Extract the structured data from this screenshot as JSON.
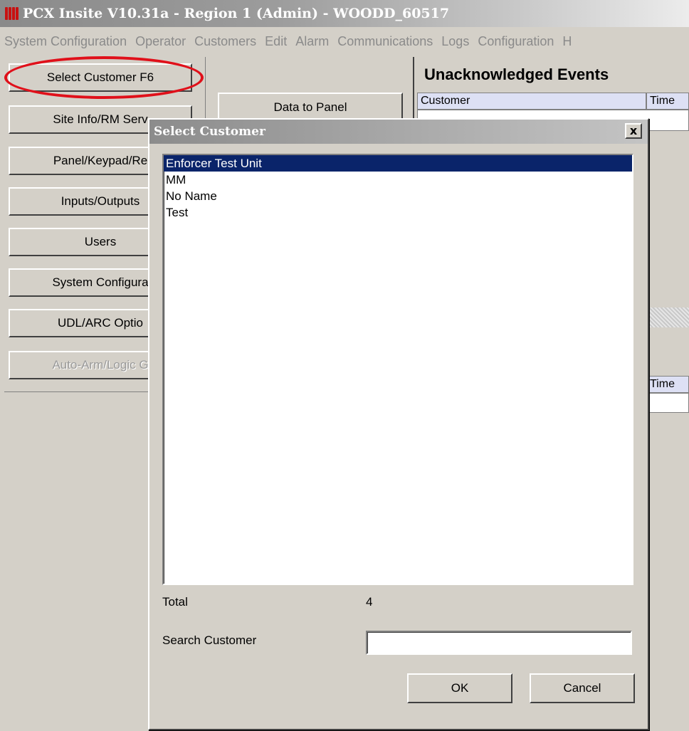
{
  "window": {
    "title": "PCX Insite V10.31a   - Region 1  (Admin) - WOODD_60517"
  },
  "menu": [
    "System Configuration",
    "Operator",
    "Customers",
    "Edit",
    "Alarm",
    "Communications",
    "Logs",
    "Configuration",
    "H"
  ],
  "left_panel": {
    "buttons": [
      {
        "label": "Select Customer F6",
        "enabled": true
      },
      {
        "label": "Site Info/RM Serv",
        "enabled": true
      },
      {
        "label": "Panel/Keypad/Re",
        "enabled": true
      },
      {
        "label": "Inputs/Outputs",
        "enabled": true
      },
      {
        "label": "Users",
        "enabled": true
      },
      {
        "label": "System Configura",
        "enabled": true
      },
      {
        "label": "UDL/ARC Optio",
        "enabled": true
      },
      {
        "label": "Auto-Arm/Logic G",
        "enabled": false
      }
    ]
  },
  "middle_panel": {
    "data_to_panel_label": "Data to Panel"
  },
  "right_panel": {
    "title": "Unacknowledged Events",
    "grid_top": {
      "col_customer": "Customer",
      "col_time": "Time"
    },
    "grid_bottom": {
      "col_time": "Time"
    }
  },
  "dialog": {
    "title": "Select Customer",
    "close_glyph": "x",
    "customers": [
      "Enforcer Test Unit",
      "MM",
      "No Name",
      "Test"
    ],
    "selected_index": 0,
    "total_label": "Total",
    "total_value": "4",
    "search_label": "Search Customer",
    "search_value": "",
    "ok_label": "OK",
    "cancel_label": "Cancel"
  },
  "colors": {
    "selection": "#0a246a",
    "annotation_ring": "#e0101a",
    "grid_header": "#dde0f4"
  }
}
